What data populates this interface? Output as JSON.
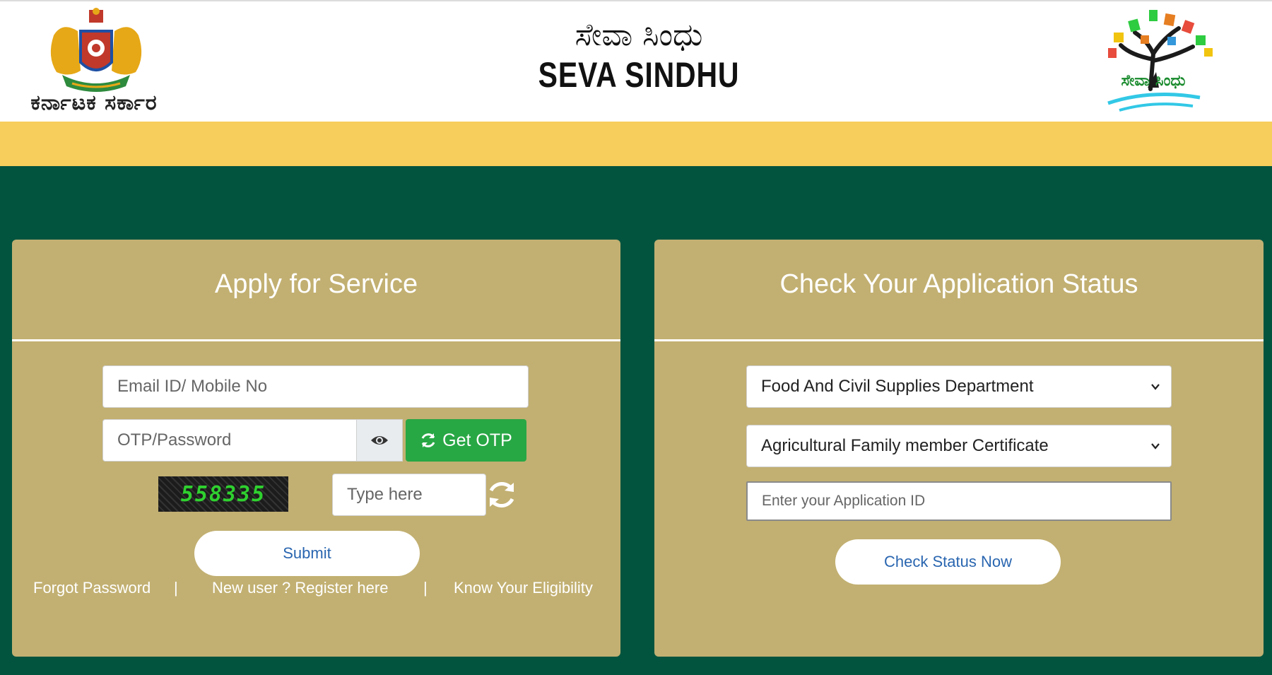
{
  "header": {
    "emblem_caption": "ಕರ್ನಾಟಕ ಸರ್ಕಾರ",
    "title_kannada": "ಸೇವಾ ಸಿಂಧು",
    "title_english": "SEVA SINDHU",
    "logo_caption": "ಸೇವಾ ಸಿಂಧು"
  },
  "apply": {
    "title": "Apply for Service",
    "email_placeholder": "Email ID/ Mobile No",
    "password_placeholder": "OTP/Password",
    "get_otp_label": "Get OTP",
    "captcha_text": "558335",
    "captcha_placeholder": "Type here",
    "submit_label": "Submit",
    "links": {
      "forgot": "Forgot Password",
      "register": "New user ? Register here",
      "eligibility": "Know Your Eligibility",
      "separator": "|"
    }
  },
  "status": {
    "title": "Check Your Application Status",
    "department_selected": "Food And Civil Supplies Department",
    "service_selected": "Agricultural Family member Certificate",
    "application_id_placeholder": "Enter your Application ID",
    "check_label": "Check Status Now"
  },
  "colors": {
    "page_green": "#03543f",
    "band_yellow": "#f7cd5b",
    "panel_tan": "#c2b072",
    "otp_green": "#28a745",
    "link_blue": "#2a66b0"
  },
  "icons": [
    "karnataka-emblem-icon",
    "seva-sindhu-tree-logo",
    "eye-icon",
    "refresh-icon",
    "captcha-refresh-icon",
    "chevron-down-icon"
  ]
}
